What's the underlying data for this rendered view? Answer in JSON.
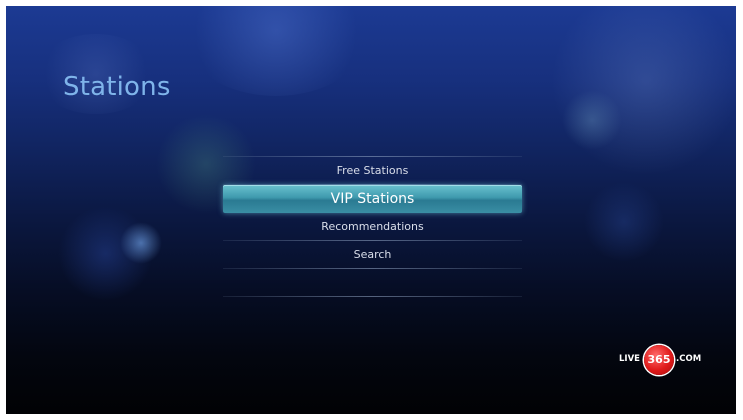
{
  "page": {
    "title": "Stations"
  },
  "menu": {
    "items": [
      {
        "label": "Free Stations"
      },
      {
        "label": "VIP Stations",
        "selected": true
      },
      {
        "label": "Recommendations"
      },
      {
        "label": "Search"
      }
    ]
  },
  "logo": {
    "left": "LIVE",
    "number": "365",
    "right": ".COM"
  },
  "colors": {
    "title": "#7fb4ea",
    "highlight": "#3e99ad",
    "logo_red": "#e01a1a"
  }
}
